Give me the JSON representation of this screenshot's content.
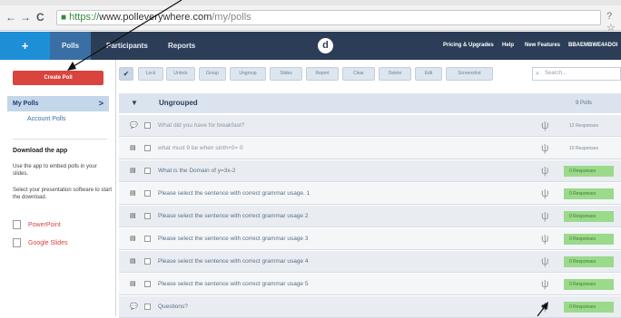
{
  "browser": {
    "back": "←",
    "forward": "→",
    "reload": "C",
    "url_scheme": "https://",
    "url_host": "www.polleverywhere.com",
    "url_path": "/my/polls",
    "end_glyphs": "? ☆"
  },
  "nav": {
    "plus": "+",
    "items": [
      "Polls",
      "Participants",
      "Reports"
    ],
    "logo": "d",
    "right_items": [
      "Pricing & Upgrades",
      "Help",
      "New Features",
      "BBAEMBWE4ADOI"
    ]
  },
  "sidebar": {
    "create_poll": "Create Poll",
    "my_polls": "My Polls",
    "my_polls_chevron": ">",
    "account_polls": "Account Polls",
    "download_title": "Download the app",
    "download_text": "Use the app to embed polls in your slides.",
    "select_text": "Select your presentation software to start the download.",
    "apps": [
      "PowerPoint",
      "Google Slides"
    ]
  },
  "toolbar": {
    "check": "✔",
    "buttons": [
      "Lock",
      "Unlock",
      "Group",
      "Ungroup",
      "Slides",
      "Report",
      "Clear",
      "Delete",
      "Edit",
      "Screenshot"
    ],
    "search_placeholder": "Search..."
  },
  "group": {
    "toggle": "▼",
    "name": "Ungrouped",
    "count": "9 Polls"
  },
  "polls": [
    {
      "type": "open",
      "title": "What did you have for breakfast?",
      "responses": "12 Responses",
      "has_responses": false
    },
    {
      "type": "mc",
      "title": "what must 9 be when sinth+0= 0",
      "responses": "10 Responses",
      "has_responses": false
    },
    {
      "type": "mc",
      "title": "What is the Domain of y=3x-2",
      "responses": "0 Responses",
      "has_responses": true
    },
    {
      "type": "mc",
      "title": "Please select the sentence with correct grammar usage. 1",
      "responses": "0 Responses",
      "has_responses": true
    },
    {
      "type": "mc",
      "title": "Please select the sentence with correct grammar usage 2",
      "responses": "0 Responses",
      "has_responses": true
    },
    {
      "type": "mc",
      "title": "Please select the sentence with correct grammar usage 3",
      "responses": "0 Responses",
      "has_responses": true
    },
    {
      "type": "mc",
      "title": "Please select the sentence with correct grammar usage 4",
      "responses": "0 Responses",
      "has_responses": true
    },
    {
      "type": "mc",
      "title": "Please select the sentence with correct grammar usage 5",
      "responses": "0 Responses",
      "has_responses": true
    },
    {
      "type": "open",
      "title": "Questions?",
      "responses": "0 Responses",
      "has_responses": true
    }
  ],
  "icons": {
    "open_question": "speech-bubble-icon",
    "multiple_choice": "list-icon",
    "fork": "fork-icon",
    "search": "magnifier-icon"
  },
  "colors": {
    "nav_bg": "#2c3e57",
    "plus_bg": "#1d8fd6",
    "create_btn": "#d9443e",
    "response_green": "#9bd98b"
  }
}
